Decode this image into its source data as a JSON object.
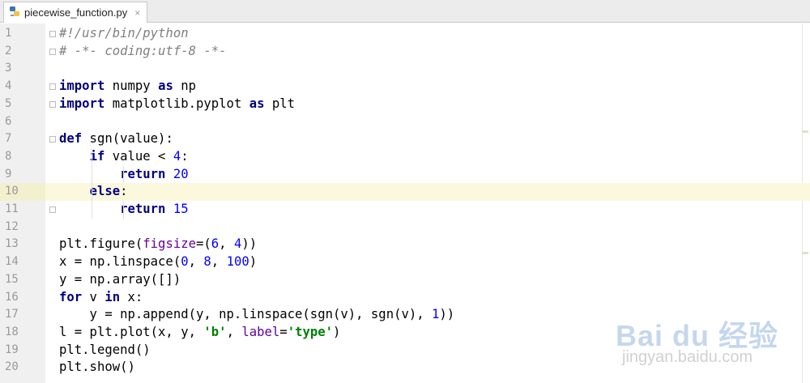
{
  "tab": {
    "filename": "piecewise_function.py",
    "icon": "python-file-icon",
    "close_glyph": "×"
  },
  "editor": {
    "current_line": 10,
    "lines": [
      {
        "n": "1",
        "tokens": [
          {
            "t": "#!/usr/bin/python",
            "c": "comment"
          }
        ]
      },
      {
        "n": "2",
        "tokens": [
          {
            "t": "# -*- coding:utf-8 -*-",
            "c": "comment"
          }
        ]
      },
      {
        "n": "3",
        "tokens": []
      },
      {
        "n": "4",
        "tokens": [
          {
            "t": "import",
            "c": "kw"
          },
          {
            "t": " numpy ",
            "c": "plain"
          },
          {
            "t": "as",
            "c": "kw"
          },
          {
            "t": " np",
            "c": "plain"
          }
        ]
      },
      {
        "n": "5",
        "tokens": [
          {
            "t": "import",
            "c": "kw"
          },
          {
            "t": " matplotlib.pyplot ",
            "c": "plain"
          },
          {
            "t": "as",
            "c": "kw"
          },
          {
            "t": " plt",
            "c": "plain"
          }
        ]
      },
      {
        "n": "6",
        "tokens": []
      },
      {
        "n": "7",
        "tokens": [
          {
            "t": "def",
            "c": "kw"
          },
          {
            "t": " sgn(value):",
            "c": "plain"
          }
        ]
      },
      {
        "n": "8",
        "tokens": [
          {
            "t": "    ",
            "c": "plain"
          },
          {
            "t": "if",
            "c": "kw"
          },
          {
            "t": " value < ",
            "c": "plain"
          },
          {
            "t": "4",
            "c": "num"
          },
          {
            "t": ":",
            "c": "plain"
          }
        ]
      },
      {
        "n": "9",
        "tokens": [
          {
            "t": "        ",
            "c": "plain"
          },
          {
            "t": "return",
            "c": "kw"
          },
          {
            "t": " ",
            "c": "plain"
          },
          {
            "t": "20",
            "c": "num"
          }
        ]
      },
      {
        "n": "10",
        "tokens": [
          {
            "t": "    ",
            "c": "plain"
          },
          {
            "t": "else",
            "c": "kw"
          },
          {
            "t": ":",
            "c": "plain"
          }
        ]
      },
      {
        "n": "11",
        "tokens": [
          {
            "t": "        ",
            "c": "plain"
          },
          {
            "t": "return",
            "c": "kw"
          },
          {
            "t": " ",
            "c": "plain"
          },
          {
            "t": "15",
            "c": "num"
          }
        ]
      },
      {
        "n": "12",
        "tokens": []
      },
      {
        "n": "13",
        "tokens": [
          {
            "t": "plt.figure(",
            "c": "plain"
          },
          {
            "t": "figsize",
            "c": "param"
          },
          {
            "t": "=(",
            "c": "plain"
          },
          {
            "t": "6",
            "c": "num"
          },
          {
            "t": ", ",
            "c": "plain"
          },
          {
            "t": "4",
            "c": "num"
          },
          {
            "t": "))",
            "c": "plain"
          }
        ]
      },
      {
        "n": "14",
        "tokens": [
          {
            "t": "x = np.linspace(",
            "c": "plain"
          },
          {
            "t": "0",
            "c": "num"
          },
          {
            "t": ", ",
            "c": "plain"
          },
          {
            "t": "8",
            "c": "num"
          },
          {
            "t": ", ",
            "c": "plain"
          },
          {
            "t": "100",
            "c": "num"
          },
          {
            "t": ")",
            "c": "plain"
          }
        ]
      },
      {
        "n": "15",
        "tokens": [
          {
            "t": "y = np.array([])",
            "c": "plain"
          }
        ]
      },
      {
        "n": "16",
        "tokens": [
          {
            "t": "for",
            "c": "kw"
          },
          {
            "t": " v ",
            "c": "plain"
          },
          {
            "t": "in",
            "c": "kw"
          },
          {
            "t": " x:",
            "c": "plain"
          }
        ]
      },
      {
        "n": "17",
        "tokens": [
          {
            "t": "    y = np.append(y, np.linspace(sgn(v), sgn(v), ",
            "c": "plain"
          },
          {
            "t": "1",
            "c": "num"
          },
          {
            "t": "))",
            "c": "plain"
          }
        ]
      },
      {
        "n": "18",
        "tokens": [
          {
            "t": "l = plt.plot(x, y, ",
            "c": "plain"
          },
          {
            "t": "'b'",
            "c": "str"
          },
          {
            "t": ", ",
            "c": "plain"
          },
          {
            "t": "label",
            "c": "param"
          },
          {
            "t": "=",
            "c": "plain"
          },
          {
            "t": "'type'",
            "c": "str"
          },
          {
            "t": ")",
            "c": "plain"
          }
        ]
      },
      {
        "n": "19",
        "tokens": [
          {
            "t": "plt.legend()",
            "c": "plain"
          }
        ]
      },
      {
        "n": "20",
        "tokens": [
          {
            "t": "plt.show()",
            "c": "plain"
          }
        ]
      }
    ]
  },
  "watermark": {
    "brand": "Bai du 经验",
    "url": "jingyan.baidu.com"
  },
  "colors": {
    "keyword": "#000080",
    "number": "#0000ff",
    "string": "#008000",
    "comment": "#808080",
    "param": "#660099",
    "current_line_bg": "#fbf8de"
  }
}
